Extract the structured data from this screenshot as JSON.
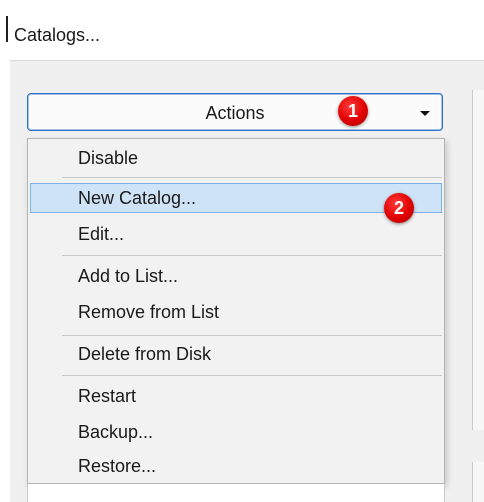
{
  "dialog": {
    "title": "Catalogs..."
  },
  "actions_button": {
    "label": "Actions"
  },
  "badges": {
    "first": "1",
    "second": "2"
  },
  "menu": {
    "items": [
      {
        "label": "Disable",
        "highlighted": false
      },
      {
        "label": "New Catalog...",
        "highlighted": true
      },
      {
        "label": "Edit...",
        "highlighted": false
      },
      {
        "label": "Add to List...",
        "highlighted": false
      },
      {
        "label": "Remove from List",
        "highlighted": false
      },
      {
        "label": "Delete from Disk",
        "highlighted": false
      },
      {
        "label": "Restart",
        "highlighted": false
      },
      {
        "label": "Backup...",
        "highlighted": false
      },
      {
        "label": "Restore...",
        "highlighted": false
      }
    ]
  },
  "colors": {
    "highlight_fill": "#cfe3f7",
    "highlight_border": "#7fb2e4",
    "button_border": "#2a73c7",
    "badge_red": "#e00000"
  }
}
